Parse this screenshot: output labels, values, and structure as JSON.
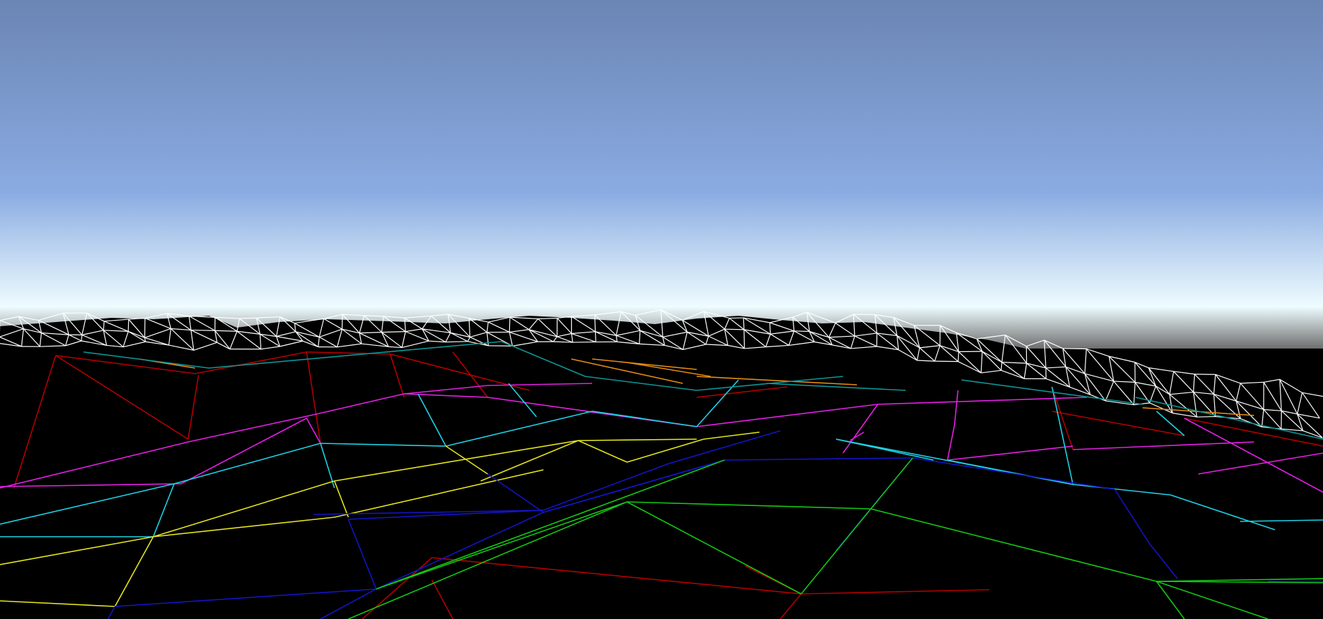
{
  "scene": {
    "sky_colors": {
      "zenith": "#6b85b4",
      "mid": "#8aabe2",
      "horizon_glow": "#eefcff",
      "ground_haze": "#6e6e6e"
    },
    "terrain_color": "#000000",
    "wire_colors": {
      "distant": "#ffffff",
      "red": "#b40000",
      "magenta": "#e620e6",
      "cyan": "#1ed2e6",
      "yellow": "#e6e61e",
      "blue": "#1414c8",
      "green": "#14c814",
      "orange": "#e68c14",
      "teal": "#0f9696"
    }
  }
}
